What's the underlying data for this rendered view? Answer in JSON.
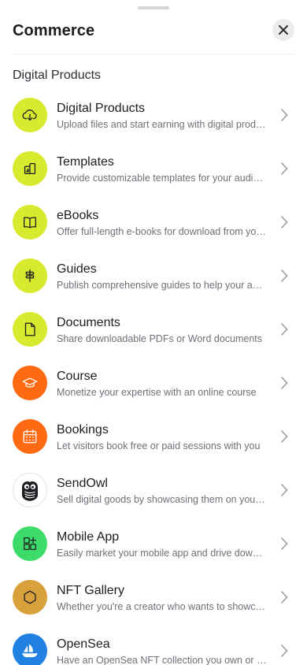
{
  "header": {
    "title": "Commerce"
  },
  "section": {
    "title": "Digital Products"
  },
  "items": [
    {
      "name": "Digital Products",
      "desc": "Upload files and start earning with digital products",
      "icon": "cloud-download-icon",
      "color": "#d7ea2d"
    },
    {
      "name": "Templates",
      "desc": "Provide customizable templates for your audience",
      "icon": "template-icon",
      "color": "#d7ea2d"
    },
    {
      "name": "eBooks",
      "desc": "Offer full-length e-books for download from your page",
      "icon": "book-icon",
      "color": "#d7ea2d"
    },
    {
      "name": "Guides",
      "desc": "Publish comprehensive guides to help your audience",
      "icon": "signpost-icon",
      "color": "#d7ea2d"
    },
    {
      "name": "Documents",
      "desc": "Share downloadable PDFs or Word documents",
      "icon": "document-icon",
      "color": "#d7ea2d"
    },
    {
      "name": "Course",
      "desc": "Monetize your expertise with an online course",
      "icon": "graduation-cap-icon",
      "color": "#ff6a13"
    },
    {
      "name": "Bookings",
      "desc": "Let visitors book free or paid sessions with you",
      "icon": "calendar-icon",
      "color": "#ff6a13"
    },
    {
      "name": "SendOwl",
      "desc": "Sell digital goods by showcasing them on your page",
      "icon": "owl-icon",
      "color": "#ffffff"
    },
    {
      "name": "Mobile App",
      "desc": "Easily market your mobile app and drive downloads",
      "icon": "apps-grid-icon",
      "color": "#3ddc6a"
    },
    {
      "name": "NFT Gallery",
      "desc": "Whether you're a creator who wants to showcase your work",
      "icon": "hexagon-icon",
      "color": "#d9a13b"
    },
    {
      "name": "OpenSea",
      "desc": "Have an OpenSea NFT collection you own or created",
      "icon": "opensea-boat-icon",
      "color": "#2081e2"
    }
  ]
}
